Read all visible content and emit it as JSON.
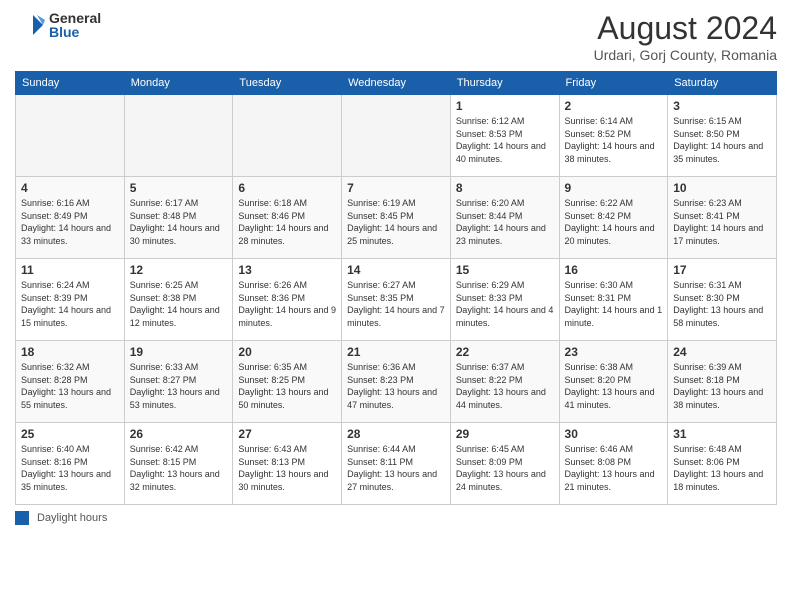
{
  "header": {
    "logo_general": "General",
    "logo_blue": "Blue",
    "month_title": "August 2024",
    "location": "Urdari, Gorj County, Romania"
  },
  "days_of_week": [
    "Sunday",
    "Monday",
    "Tuesday",
    "Wednesday",
    "Thursday",
    "Friday",
    "Saturday"
  ],
  "footer_legend": "Daylight hours",
  "weeks": [
    [
      {
        "day": "",
        "empty": true
      },
      {
        "day": "",
        "empty": true
      },
      {
        "day": "",
        "empty": true
      },
      {
        "day": "",
        "empty": true
      },
      {
        "day": "1",
        "sunrise": "6:12 AM",
        "sunset": "8:53 PM",
        "daylight": "14 hours and 40 minutes."
      },
      {
        "day": "2",
        "sunrise": "6:14 AM",
        "sunset": "8:52 PM",
        "daylight": "14 hours and 38 minutes."
      },
      {
        "day": "3",
        "sunrise": "6:15 AM",
        "sunset": "8:50 PM",
        "daylight": "14 hours and 35 minutes."
      }
    ],
    [
      {
        "day": "4",
        "sunrise": "6:16 AM",
        "sunset": "8:49 PM",
        "daylight": "14 hours and 33 minutes."
      },
      {
        "day": "5",
        "sunrise": "6:17 AM",
        "sunset": "8:48 PM",
        "daylight": "14 hours and 30 minutes."
      },
      {
        "day": "6",
        "sunrise": "6:18 AM",
        "sunset": "8:46 PM",
        "daylight": "14 hours and 28 minutes."
      },
      {
        "day": "7",
        "sunrise": "6:19 AM",
        "sunset": "8:45 PM",
        "daylight": "14 hours and 25 minutes."
      },
      {
        "day": "8",
        "sunrise": "6:20 AM",
        "sunset": "8:44 PM",
        "daylight": "14 hours and 23 minutes."
      },
      {
        "day": "9",
        "sunrise": "6:22 AM",
        "sunset": "8:42 PM",
        "daylight": "14 hours and 20 minutes."
      },
      {
        "day": "10",
        "sunrise": "6:23 AM",
        "sunset": "8:41 PM",
        "daylight": "14 hours and 17 minutes."
      }
    ],
    [
      {
        "day": "11",
        "sunrise": "6:24 AM",
        "sunset": "8:39 PM",
        "daylight": "14 hours and 15 minutes."
      },
      {
        "day": "12",
        "sunrise": "6:25 AM",
        "sunset": "8:38 PM",
        "daylight": "14 hours and 12 minutes."
      },
      {
        "day": "13",
        "sunrise": "6:26 AM",
        "sunset": "8:36 PM",
        "daylight": "14 hours and 9 minutes."
      },
      {
        "day": "14",
        "sunrise": "6:27 AM",
        "sunset": "8:35 PM",
        "daylight": "14 hours and 7 minutes."
      },
      {
        "day": "15",
        "sunrise": "6:29 AM",
        "sunset": "8:33 PM",
        "daylight": "14 hours and 4 minutes."
      },
      {
        "day": "16",
        "sunrise": "6:30 AM",
        "sunset": "8:31 PM",
        "daylight": "14 hours and 1 minute."
      },
      {
        "day": "17",
        "sunrise": "6:31 AM",
        "sunset": "8:30 PM",
        "daylight": "13 hours and 58 minutes."
      }
    ],
    [
      {
        "day": "18",
        "sunrise": "6:32 AM",
        "sunset": "8:28 PM",
        "daylight": "13 hours and 55 minutes."
      },
      {
        "day": "19",
        "sunrise": "6:33 AM",
        "sunset": "8:27 PM",
        "daylight": "13 hours and 53 minutes."
      },
      {
        "day": "20",
        "sunrise": "6:35 AM",
        "sunset": "8:25 PM",
        "daylight": "13 hours and 50 minutes."
      },
      {
        "day": "21",
        "sunrise": "6:36 AM",
        "sunset": "8:23 PM",
        "daylight": "13 hours and 47 minutes."
      },
      {
        "day": "22",
        "sunrise": "6:37 AM",
        "sunset": "8:22 PM",
        "daylight": "13 hours and 44 minutes."
      },
      {
        "day": "23",
        "sunrise": "6:38 AM",
        "sunset": "8:20 PM",
        "daylight": "13 hours and 41 minutes."
      },
      {
        "day": "24",
        "sunrise": "6:39 AM",
        "sunset": "8:18 PM",
        "daylight": "13 hours and 38 minutes."
      }
    ],
    [
      {
        "day": "25",
        "sunrise": "6:40 AM",
        "sunset": "8:16 PM",
        "daylight": "13 hours and 35 minutes."
      },
      {
        "day": "26",
        "sunrise": "6:42 AM",
        "sunset": "8:15 PM",
        "daylight": "13 hours and 32 minutes."
      },
      {
        "day": "27",
        "sunrise": "6:43 AM",
        "sunset": "8:13 PM",
        "daylight": "13 hours and 30 minutes."
      },
      {
        "day": "28",
        "sunrise": "6:44 AM",
        "sunset": "8:11 PM",
        "daylight": "13 hours and 27 minutes."
      },
      {
        "day": "29",
        "sunrise": "6:45 AM",
        "sunset": "8:09 PM",
        "daylight": "13 hours and 24 minutes."
      },
      {
        "day": "30",
        "sunrise": "6:46 AM",
        "sunset": "8:08 PM",
        "daylight": "13 hours and 21 minutes."
      },
      {
        "day": "31",
        "sunrise": "6:48 AM",
        "sunset": "8:06 PM",
        "daylight": "13 hours and 18 minutes."
      }
    ]
  ]
}
